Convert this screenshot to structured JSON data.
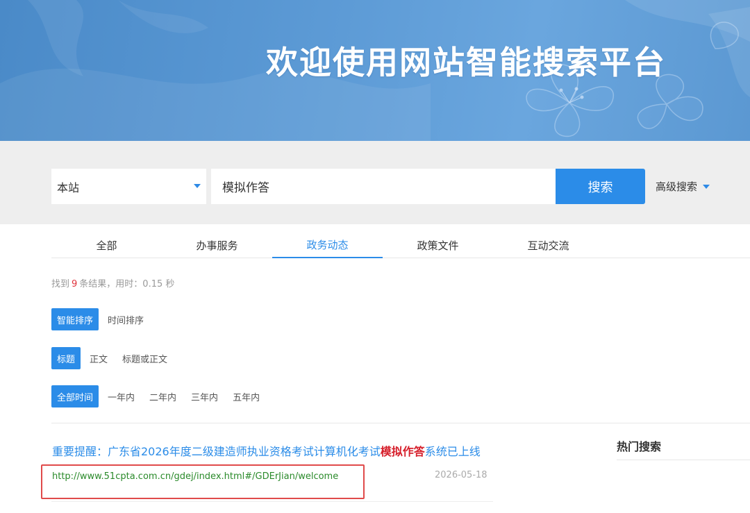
{
  "banner": {
    "title": "欢迎使用网站智能搜索平台"
  },
  "search": {
    "scope_value": "本站",
    "query_value": "模拟作答",
    "search_button_label": "搜索",
    "advanced_label": "高级搜索"
  },
  "tabs": [
    {
      "label": "全部",
      "active": false
    },
    {
      "label": "办事服务",
      "active": false
    },
    {
      "label": "政务动态",
      "active": true
    },
    {
      "label": "政策文件",
      "active": false
    },
    {
      "label": "互动交流",
      "active": false
    }
  ],
  "stats": {
    "prefix": "找到",
    "count": "9",
    "suffix": "条结果，用时：0.15 秒"
  },
  "filters": {
    "sort": [
      "智能排序",
      "时间排序"
    ],
    "field": [
      "标题",
      "正文",
      "标题或正文"
    ],
    "time": [
      "全部时间",
      "一年内",
      "二年内",
      "三年内",
      "五年内"
    ]
  },
  "result": {
    "title_before": "重要提醒：广东省2026年度二级建造师执业资格考试计算机化考试",
    "title_highlight": "模拟作答",
    "title_after": "系统已上线",
    "url": "http://www.51cpta.com.cn/gdej/index.html#/GDErJian/welcome",
    "date": "2026-05-18"
  },
  "sidebar": {
    "hot_title": "热门搜索"
  },
  "colors": {
    "accent": "#2b8ce8",
    "highlight_red": "#d6202c",
    "url_green": "#2a8a2a",
    "annotation_box": "#e04a4a"
  }
}
